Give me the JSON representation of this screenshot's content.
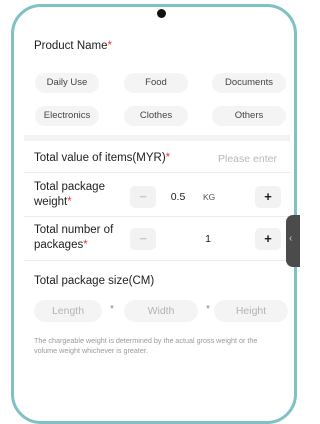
{
  "product_name": {
    "label": "Product Name",
    "required_mark": "*"
  },
  "categories": [
    "Daily Use",
    "Food",
    "Documents",
    "Electronics",
    "Clothes",
    "Others"
  ],
  "total_value": {
    "label": "Total value of items(MYR)",
    "required_mark": "*",
    "placeholder": "Please enter"
  },
  "package_weight": {
    "label_line1": "Total package",
    "label_line2": "weight",
    "required_mark": "*",
    "minus": "−",
    "value": "0.5",
    "unit": "KG",
    "plus": "+"
  },
  "package_count": {
    "label_line1": "Total number of",
    "label_line2": "packages",
    "required_mark": "*",
    "minus": "−",
    "value": "1",
    "plus": "+"
  },
  "package_size": {
    "label": "Total package size(CM)",
    "length": "Length",
    "width": "Width",
    "height": "Height",
    "separator": "*"
  },
  "note": "The chargeable weight is determined by the actual gross weight or the volume weight whichever is greater.",
  "side_handle_icon": "chevron-left-icon",
  "colors": {
    "frame": "#7fc1c4",
    "required": "#e53a3a",
    "chip_bg": "#f4f4f4"
  }
}
